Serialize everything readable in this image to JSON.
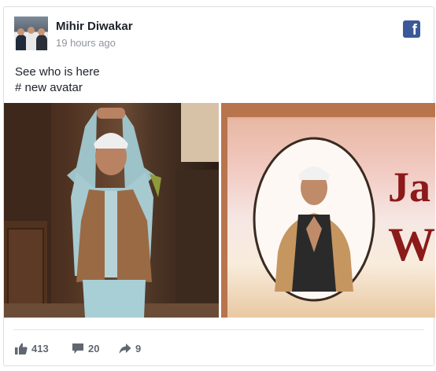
{
  "post": {
    "author": "Mihir Diwakar",
    "time": "19 hours ago",
    "text_lines": [
      "See who is here",
      "# new avatar"
    ]
  },
  "media": {
    "left_image": "photo-dhoni-cutout",
    "right_image": "photo-dhoni-poster",
    "poster_text": "Ja\nW"
  },
  "stats": {
    "likes": "413",
    "comments": "20",
    "shares": "9"
  },
  "colors": {
    "facebook_blue": "#3b5998",
    "muted": "#90949c",
    "text": "#1d2129"
  }
}
